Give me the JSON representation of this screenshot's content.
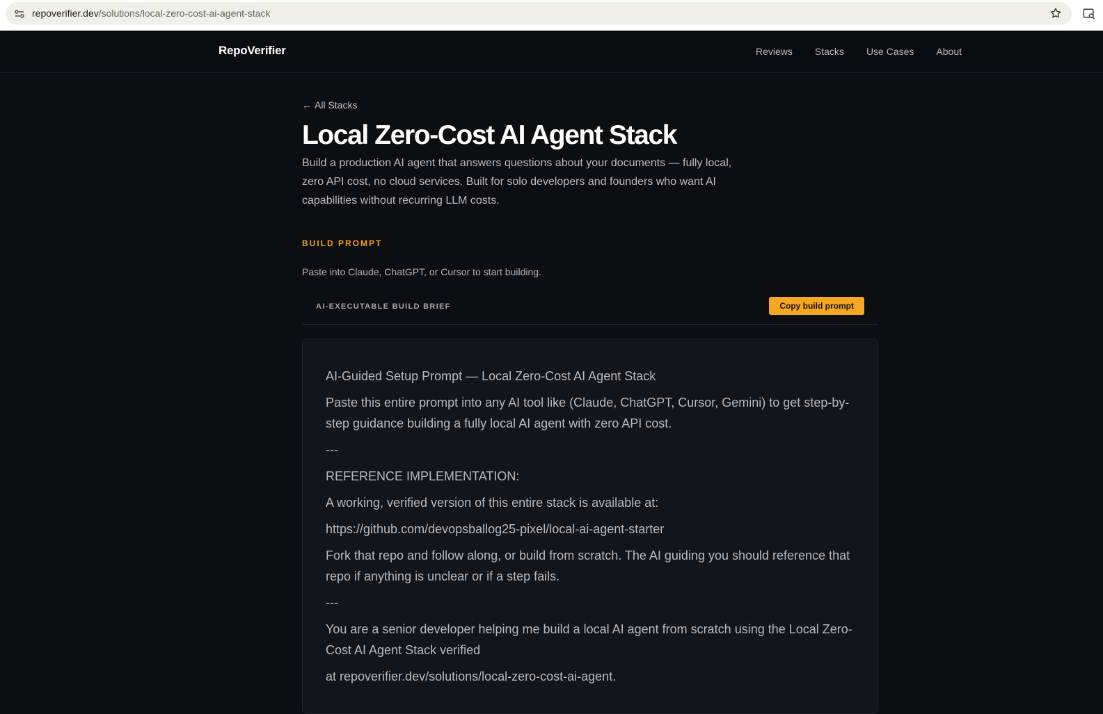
{
  "browser": {
    "url_host": "repoverifier.dev",
    "url_path": "/solutions/local-zero-cost-ai-agent-stack"
  },
  "nav": {
    "brand": "RepoVerifier",
    "links": [
      "Reviews",
      "Stacks",
      "Use Cases",
      "About"
    ]
  },
  "page": {
    "back_label": "All Stacks",
    "title": "Local Zero-Cost AI Agent Stack",
    "intro": "Build a production AI agent that answers questions about your documents — fully local, zero API cost, no cloud services. Built for solo developers and founders who want AI capabilities without recurring LLM costs.",
    "section_label": "BUILD PROMPT",
    "section_sub": "Paste into Claude, ChatGPT, or Cursor to start building.",
    "brief_label": "AI-EXECUTABLE BUILD BRIEF",
    "copy_label": "Copy build prompt"
  },
  "prompt": {
    "lines": [
      "AI-Guided Setup Prompt — Local Zero-Cost AI Agent Stack",
      "Paste this entire prompt into any AI tool like (Claude, ChatGPT, Cursor, Gemini) to get step-by-step guidance building a fully local AI agent with zero API cost.",
      "---",
      "REFERENCE IMPLEMENTATION:",
      "A working, verified version of this entire stack is available at:",
      "https://github.com/devopsballog25-pixel/local-ai-agent-starter",
      "Fork that repo and follow along, or build from scratch. The AI guiding you should reference that repo if anything is unclear or if a step fails.",
      "---",
      "You are a senior developer helping me build a local AI agent from scratch using the Local Zero-Cost AI Agent Stack verified",
      "at repoverifier.dev/solutions/local-zero-cost-ai-agent."
    ]
  },
  "colors": {
    "accent": "#f5a623",
    "background": "#0d0e12"
  }
}
